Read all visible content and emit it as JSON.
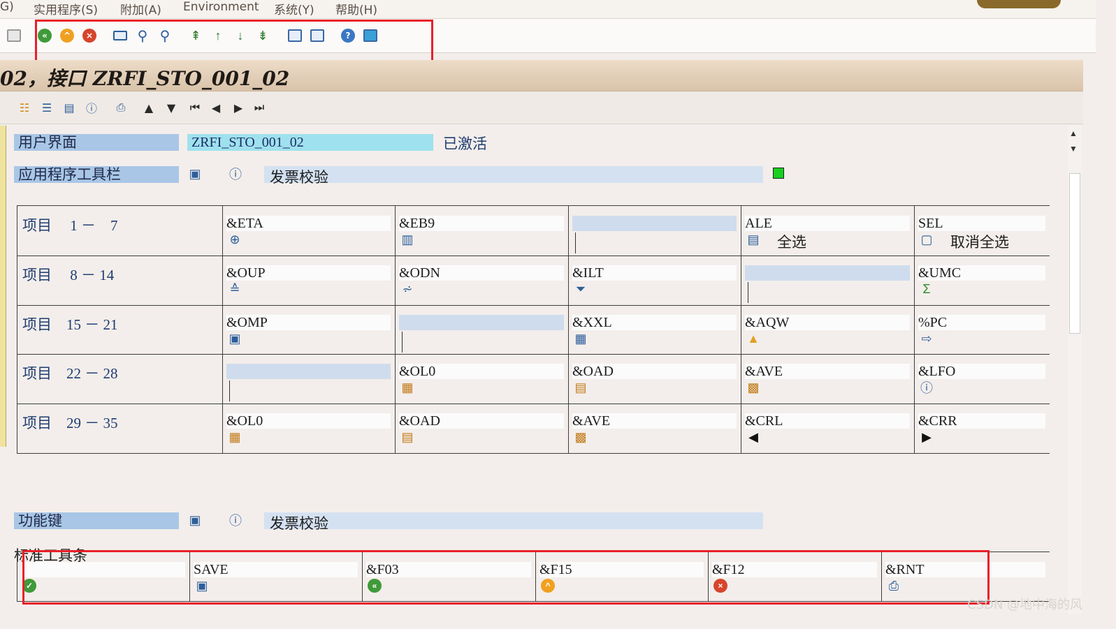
{
  "menubar": {
    "items": [
      "G)",
      "实用程序(S)",
      "附加(A)",
      "Environment",
      "系统(Y)",
      "帮助(H)"
    ]
  },
  "toolbar": {
    "icons": [
      "back-icon",
      "exit-icon",
      "cancel-icon",
      "print-icon",
      "find-icon",
      "find-next-icon",
      "first-page-icon",
      "previous-page-icon",
      "next-page-icon",
      "last-page-icon",
      "create-session-icon",
      "shortcut-icon",
      "help-icon",
      "layout-icon"
    ]
  },
  "title": "02，接口 ZRFI_STO_001_02",
  "app_toolbar": {
    "icons": [
      "hierarchy-icon",
      "align-icon",
      "table-icon",
      "info-icon",
      "print-icon",
      "arrow-up-icon",
      "arrow-down-icon",
      "first-icon",
      "prev-icon",
      "next-icon",
      "last-icon"
    ]
  },
  "interface": {
    "label": "用户界面",
    "value": "ZRFI_STO_001_02",
    "status": "已激活"
  },
  "app_toolbar_section": {
    "label": "应用程序工具栏",
    "description": "发票校验",
    "status_color": "#17d020"
  },
  "app_toolbar_rows": [
    {
      "label": "项目　 1 －　7",
      "cells": [
        {
          "code": "&ETA",
          "icon": "detail-icon",
          "text": ""
        },
        {
          "code": "&EB9",
          "icon": "chart-icon",
          "text": ""
        },
        {
          "code": "",
          "icon": "",
          "text": ""
        },
        {
          "code": "ALE",
          "icon": "select-all-icon",
          "text": "全选"
        },
        {
          "code": "SEL",
          "icon": "deselect-all-icon",
          "text": "取消全选"
        }
      ]
    },
    {
      "label": "项目　 8 － 14",
      "cells": [
        {
          "code": "&OUP",
          "icon": "sort-asc-icon",
          "text": ""
        },
        {
          "code": "&ODN",
          "icon": "sort-desc-icon",
          "text": ""
        },
        {
          "code": "&ILT",
          "icon": "filter-icon",
          "text": ""
        },
        {
          "code": "",
          "icon": "",
          "text": ""
        },
        {
          "code": "&UMC",
          "icon": "sum-icon",
          "text": ""
        }
      ]
    },
    {
      "label": "项目　15 － 21",
      "cells": [
        {
          "code": "&OMP",
          "icon": "print-preview-icon",
          "text": ""
        },
        {
          "code": "",
          "icon": "",
          "text": ""
        },
        {
          "code": "&XXL",
          "icon": "excel-icon",
          "text": ""
        },
        {
          "code": "&AQW",
          "icon": "word-icon",
          "text": ""
        },
        {
          "code": "%PC",
          "icon": "export-icon",
          "text": ""
        }
      ]
    },
    {
      "label": "项目　22 － 28",
      "cells": [
        {
          "code": "",
          "icon": "",
          "text": ""
        },
        {
          "code": "&OL0",
          "icon": "layout-grid-icon",
          "text": ""
        },
        {
          "code": "&OAD",
          "icon": "choose-layout-icon",
          "text": ""
        },
        {
          "code": "&AVE",
          "icon": "save-layout-icon",
          "text": ""
        },
        {
          "code": "&LFO",
          "icon": "info-icon",
          "text": ""
        }
      ]
    },
    {
      "label": "项目　29 － 35",
      "cells": [
        {
          "code": "&OL0",
          "icon": "layout-grid-icon",
          "text": ""
        },
        {
          "code": "&OAD",
          "icon": "choose-layout-icon",
          "text": ""
        },
        {
          "code": "&AVE",
          "icon": "save-layout-icon",
          "text": ""
        },
        {
          "code": "&CRL",
          "icon": "arrow-left-icon",
          "text": ""
        },
        {
          "code": "&CRR",
          "icon": "arrow-right-icon",
          "text": ""
        }
      ]
    }
  ],
  "function_keys": {
    "label": "功能键",
    "description": "发票校验"
  },
  "standard_toolbar": {
    "label": "标准工具条",
    "cells": [
      {
        "code": "",
        "icon": "check-icon"
      },
      {
        "code": "SAVE",
        "icon": "save-icon"
      },
      {
        "code": "&F03",
        "icon": "back-icon"
      },
      {
        "code": "&F15",
        "icon": "exit-icon"
      },
      {
        "code": "&F12",
        "icon": "cancel-icon"
      },
      {
        "code": "&RNT",
        "icon": "print-icon"
      }
    ]
  },
  "watermark": "CSDN @地中海的风",
  "colors": {
    "highlight": "#e8202a",
    "label_blue": "#a9c6e6",
    "cyan": "#9fe1ee"
  }
}
